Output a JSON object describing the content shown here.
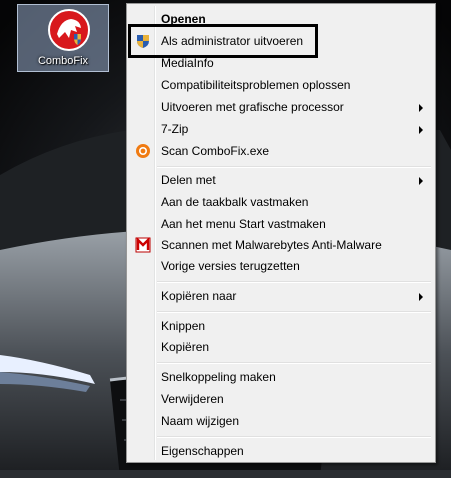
{
  "desktop": {
    "icon_label": "ComboFix"
  },
  "menu": {
    "items": [
      {
        "label": "Openen"
      },
      {
        "label": "Als administrator uitvoeren",
        "icon": "uac-shield-icon"
      },
      {
        "label": "MediaInfo"
      },
      {
        "label": "Compatibiliteitsproblemen oplossen"
      },
      {
        "label": "Uitvoeren met grafische processor",
        "submenu": true
      },
      {
        "label": "7-Zip",
        "submenu": true
      },
      {
        "label": "Scan ComboFix.exe",
        "icon": "avast-scan-icon"
      },
      {
        "label": "Delen met",
        "submenu": true
      },
      {
        "label": "Aan de taakbalk vastmaken"
      },
      {
        "label": "Aan het menu Start vastmaken"
      },
      {
        "label": "Scannen met Malwarebytes Anti-Malware",
        "icon": "malwarebytes-icon"
      },
      {
        "label": "Vorige versies terugzetten"
      },
      {
        "label": "Kopiëren naar",
        "submenu": true
      },
      {
        "label": "Knippen"
      },
      {
        "label": "Kopiëren"
      },
      {
        "label": "Snelkoppeling maken"
      },
      {
        "label": "Verwijderen"
      },
      {
        "label": "Naam wijzigen"
      },
      {
        "label": "Eigenschappen"
      }
    ]
  }
}
